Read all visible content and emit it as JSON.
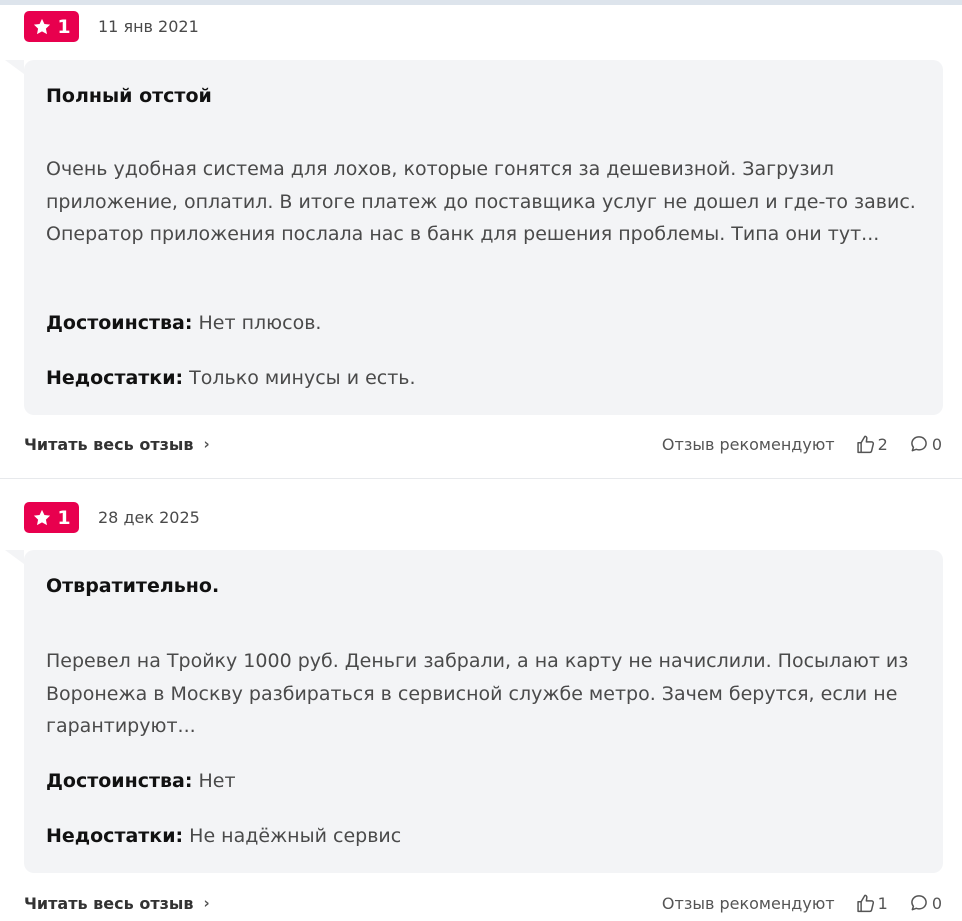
{
  "reviews": [
    {
      "rating": "1",
      "date": "11 янв 2021",
      "title": "Полный отстой",
      "text": "Очень удобная система для лохов, которые гонятся за дешевизной. Загрузил приложение, оплатил. В итоге платеж до поставщика услуг не дошел и где-то завис. Оператор приложения послала нас в банк для решения проблемы. Типа они тут...",
      "pros_label": "Достоинства:",
      "pros_value": "Нет плюсов.",
      "cons_label": "Недостатки:",
      "cons_value": "Только минусы и есть.",
      "read_more": "Читать весь отзыв",
      "recommend_label": "Отзыв рекомендуют",
      "likes": "2",
      "comments": "0"
    },
    {
      "rating": "1",
      "date": "28 дек 2025",
      "title": "Отвратительно.",
      "text": "Перевел на Тройку 1000 руб. Деньги забрали, а на карту не начислили. Посылают из Воронежа в Москву разбираться в сервисной службе метро. Зачем берутся, если не гарантируют...",
      "pros_label": "Достоинства:",
      "pros_value": "Нет",
      "cons_label": "Недостатки:",
      "cons_value": "Не надёжный сервис",
      "read_more": "Читать весь отзыв",
      "recommend_label": "Отзыв рекомендуют",
      "likes": "1",
      "comments": "0"
    }
  ],
  "icons": {
    "rating": "star-icon",
    "more": "chevron-right-icon",
    "like": "thumbs-up-icon",
    "comment": "comment-bubble-icon"
  },
  "colors": {
    "accent": "#e8004e",
    "card": "#f3f4f6"
  }
}
